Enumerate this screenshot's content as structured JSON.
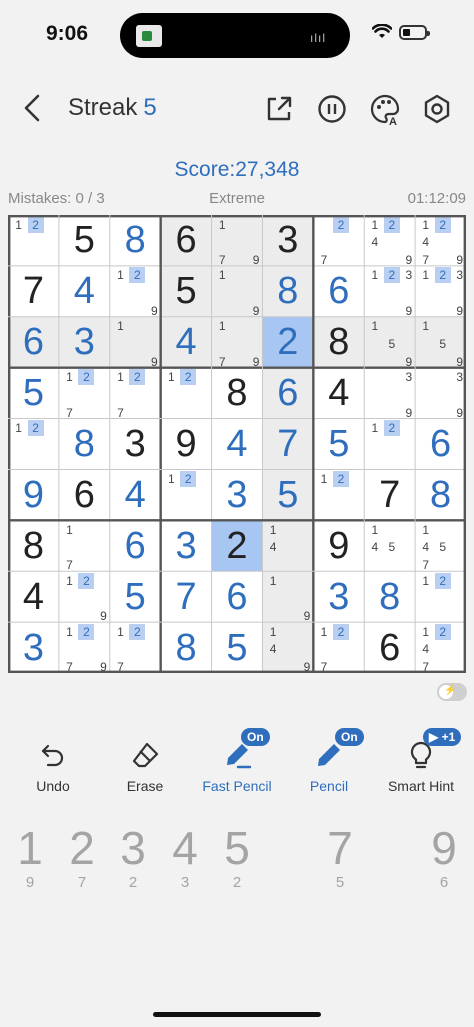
{
  "status": {
    "time": "9:06"
  },
  "header": {
    "title": "Streak",
    "streak": "5"
  },
  "score": "Score:27,348",
  "info": {
    "mistakes": "Mistakes: 0 / 3",
    "difficulty": "Extreme",
    "timer": "01:12:09"
  },
  "board": {
    "cells": [
      [
        {
          "n": [
            1,
            2
          ],
          "h": [
            2
          ]
        },
        {
          "v": "5",
          "t": "g"
        },
        {
          "v": "8",
          "t": "u"
        },
        {
          "v": "6",
          "t": "g"
        },
        {
          "n": [
            1,
            7,
            9
          ],
          "h": []
        },
        {
          "v": "3",
          "t": "g"
        },
        {
          "n": [
            2,
            7
          ],
          "h": [
            2
          ]
        },
        {
          "n": [
            1,
            2,
            4,
            9
          ],
          "h": [
            2
          ]
        },
        {
          "n": [
            1,
            2,
            4,
            7,
            9
          ],
          "h": [
            2
          ]
        }
      ],
      [
        {
          "v": "7",
          "t": "g"
        },
        {
          "v": "4",
          "t": "u"
        },
        {
          "n": [
            1,
            2,
            9
          ],
          "h": [
            2
          ]
        },
        {
          "v": "5",
          "t": "g"
        },
        {
          "n": [
            1,
            9
          ],
          "h": []
        },
        {
          "v": "8",
          "t": "u"
        },
        {
          "v": "6",
          "t": "u"
        },
        {
          "n": [
            1,
            2,
            3,
            9
          ],
          "h": [
            2
          ]
        },
        {
          "n": [
            1,
            2,
            3,
            9
          ],
          "h": [
            2
          ]
        }
      ],
      [
        {
          "v": "6",
          "t": "u"
        },
        {
          "v": "3",
          "t": "u"
        },
        {
          "n": [
            1,
            9
          ],
          "h": []
        },
        {
          "v": "4",
          "t": "u"
        },
        {
          "n": [
            1,
            7,
            9
          ],
          "h": []
        },
        {
          "v": "2",
          "t": "u"
        },
        {
          "v": "8",
          "t": "g"
        },
        {
          "n": [
            1,
            5,
            9
          ],
          "h": []
        },
        {
          "n": [
            1,
            5,
            9
          ],
          "h": []
        }
      ],
      [
        {
          "v": "5",
          "t": "u"
        },
        {
          "n": [
            1,
            2,
            7
          ],
          "h": [
            2
          ]
        },
        {
          "n": [
            1,
            2,
            7
          ],
          "h": [
            2
          ]
        },
        {
          "n": [
            1,
            2
          ],
          "h": [
            2
          ]
        },
        {
          "v": "8",
          "t": "g"
        },
        {
          "v": "6",
          "t": "u"
        },
        {
          "v": "4",
          "t": "g"
        },
        {
          "n": [
            3,
            9
          ],
          "h": []
        },
        {
          "n": [
            3,
            9
          ],
          "h": []
        }
      ],
      [
        {
          "n": [
            1,
            2
          ],
          "h": [
            2
          ]
        },
        {
          "v": "8",
          "t": "u"
        },
        {
          "v": "3",
          "t": "g"
        },
        {
          "v": "9",
          "t": "g"
        },
        {
          "v": "4",
          "t": "u"
        },
        {
          "v": "7",
          "t": "u"
        },
        {
          "v": "5",
          "t": "u"
        },
        {
          "n": [
            1,
            2
          ],
          "h": [
            2
          ]
        },
        {
          "v": "6",
          "t": "u"
        }
      ],
      [
        {
          "v": "9",
          "t": "u"
        },
        {
          "v": "6",
          "t": "g"
        },
        {
          "v": "4",
          "t": "u"
        },
        {
          "n": [
            1,
            2
          ],
          "h": [
            2
          ]
        },
        {
          "v": "3",
          "t": "u"
        },
        {
          "v": "5",
          "t": "u"
        },
        {
          "n": [
            1,
            2
          ],
          "h": [
            2
          ]
        },
        {
          "v": "7",
          "t": "g"
        },
        {
          "v": "8",
          "t": "u"
        }
      ],
      [
        {
          "v": "8",
          "t": "g"
        },
        {
          "n": [
            1,
            7
          ],
          "h": []
        },
        {
          "v": "6",
          "t": "u"
        },
        {
          "v": "3",
          "t": "u"
        },
        {
          "v": "2",
          "t": "g"
        },
        {
          "n": [
            1,
            4
          ],
          "h": []
        },
        {
          "v": "9",
          "t": "g"
        },
        {
          "n": [
            1,
            4,
            5
          ],
          "h": []
        },
        {
          "n": [
            1,
            4,
            5,
            7
          ],
          "h": []
        }
      ],
      [
        {
          "v": "4",
          "t": "g"
        },
        {
          "n": [
            1,
            2,
            9
          ],
          "h": [
            2
          ]
        },
        {
          "v": "5",
          "t": "u"
        },
        {
          "v": "7",
          "t": "u"
        },
        {
          "v": "6",
          "t": "u"
        },
        {
          "n": [
            1,
            9
          ],
          "h": []
        },
        {
          "v": "3",
          "t": "u"
        },
        {
          "v": "8",
          "t": "u"
        },
        {
          "n": [
            1,
            2
          ],
          "h": [
            2
          ]
        }
      ],
      [
        {
          "v": "3",
          "t": "u"
        },
        {
          "n": [
            1,
            2,
            7,
            9
          ],
          "h": [
            2
          ]
        },
        {
          "n": [
            1,
            2,
            7
          ],
          "h": [
            2
          ]
        },
        {
          "v": "8",
          "t": "u"
        },
        {
          "v": "5",
          "t": "u"
        },
        {
          "n": [
            1,
            4,
            9
          ],
          "h": []
        },
        {
          "n": [
            1,
            2,
            7
          ],
          "h": [
            2
          ]
        },
        {
          "v": "6",
          "t": "g"
        },
        {
          "n": [
            1,
            2,
            4,
            7
          ],
          "h": [
            2
          ]
        }
      ]
    ],
    "selected": [
      2,
      5
    ],
    "same_value": [
      6,
      4
    ]
  },
  "tools": {
    "undo": "Undo",
    "erase": "Erase",
    "fast_pencil": "Fast Pencil",
    "fast_pencil_badge": "On",
    "pencil": "Pencil",
    "pencil_badge": "On",
    "hint": "Smart Hint",
    "hint_badge": "▶ +1"
  },
  "numpad": [
    {
      "num": "1",
      "count": "9"
    },
    {
      "num": "2",
      "count": "7"
    },
    {
      "num": "3",
      "count": "2"
    },
    {
      "num": "4",
      "count": "3"
    },
    {
      "num": "5",
      "count": "2"
    },
    {
      "num": "7",
      "count": "5"
    },
    {
      "num": "9",
      "count": "6"
    }
  ],
  "colors": {
    "accent": "#2f6ebd",
    "highlight_note": "#b8cff2",
    "selected_cell": "#a8c6f2",
    "related_cell": "#ececec"
  }
}
